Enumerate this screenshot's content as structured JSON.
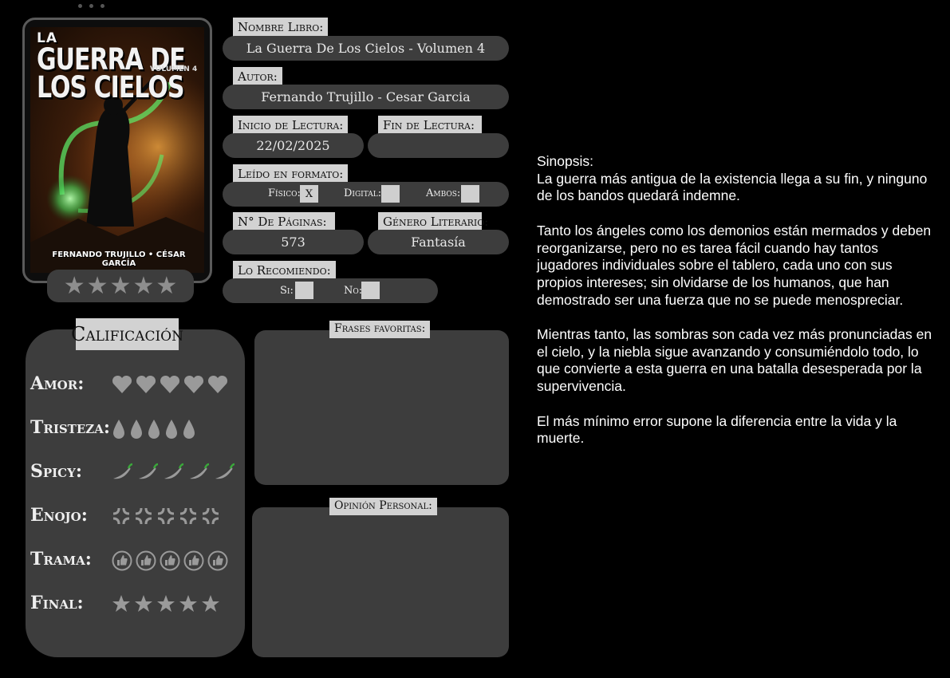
{
  "cover": {
    "title_line1": "LA",
    "title_line2": "GUERRA DE LOS CIELOS",
    "subtitle": "VOLUMEN 4",
    "authors": "FERNANDO TRUJILLO • CÉSAR GARCÍA"
  },
  "overall_rating": {
    "stars": 5,
    "max": 5
  },
  "form": {
    "book_label": "Nombre Libro:",
    "book_value": "La Guerra De Los Cielos - Volumen 4",
    "author_label": "Autor:",
    "author_value": "Fernando Trujillo - Cesar Garcia",
    "start_label": "Inicio de Lectura:",
    "start_value": "22/02/2025",
    "end_label": "Fin de Lectura:",
    "end_value": "",
    "format_label": "Leído en formato:",
    "physical_label": "Físico:",
    "physical_value": "X",
    "digital_label": "Digital:",
    "digital_value": "",
    "both_label": "Ambos:",
    "both_value": "",
    "pages_label": "N° De Páginas:",
    "pages_value": "573",
    "genre_label": "Género Literario:",
    "genre_value": "Fantasía",
    "recommend_label": "Lo Recomiendo:",
    "yes_label": "Si:",
    "yes_value": "",
    "no_label": "No:",
    "no_value": ""
  },
  "rating": {
    "title": "Calificación",
    "rows": [
      {
        "label": "Amor:",
        "icon": "heart-icon",
        "count": 5
      },
      {
        "label": "Tristeza:",
        "icon": "teardrop-icon",
        "count": 5
      },
      {
        "label": "Spicy:",
        "icon": "chili-pepper-icon",
        "count": 5
      },
      {
        "label": "Enojo:",
        "icon": "anger-icon",
        "count": 5
      },
      {
        "label": "Trama:",
        "icon": "thumbs-up-icon",
        "count": 5
      },
      {
        "label": "Final:",
        "icon": "star-icon",
        "count": 5
      }
    ]
  },
  "favorite_quotes": {
    "label": "Frases favoritas:",
    "content": ""
  },
  "personal_opinion": {
    "label": "Opinión Personal:",
    "content": ""
  },
  "synopsis": {
    "heading": "Sinopsis:",
    "paragraphs": [
      "La guerra más antigua de la existencia llega a su fin, y ninguno de los bandos quedará indemne.",
      "Tanto los ángeles como los demonios están mermados y deben reorganizarse, pero no es tarea fácil cuando hay tantos jugadores individuales sobre el tablero, cada uno con sus propios intereses; sin olvidarse de los humanos, que han demostrado ser una fuerza que no se puede menospreciar.",
      "Mientras tanto, las sombras son cada vez más pronunciadas en el cielo, y la niebla sigue avanzando y consumiéndolo todo, lo que convierte a esta guerra en una batalla desesperada por la supervivencia.",
      "El más mínimo error supone la diferencia entre la vida y la muerte."
    ]
  },
  "colors": {
    "background": "#000000",
    "panel": "#3d3d3d",
    "label_bg": "#d2d2d2",
    "icon_gray": "#9a9a9a",
    "cover_glow": "#49d85a"
  }
}
